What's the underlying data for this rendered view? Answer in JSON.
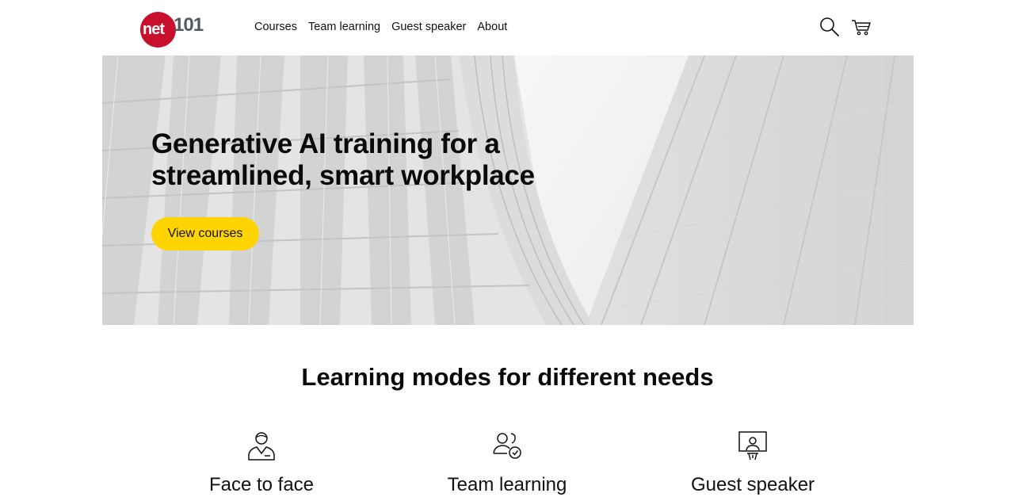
{
  "logo": {
    "prefix": "net",
    "suffix": "101",
    "brand_color": "#c8102e"
  },
  "nav": {
    "items": [
      {
        "label": "Courses"
      },
      {
        "label": "Team learning"
      },
      {
        "label": "Guest speaker"
      },
      {
        "label": "About"
      }
    ]
  },
  "header_icons": {
    "search": "search-icon",
    "cart": "cart-icon"
  },
  "hero": {
    "title": "Generative AI training for a streamlined, smart workplace",
    "cta_label": "View courses",
    "cta_color": "#ffd400"
  },
  "modes": {
    "title": "Learning modes for different needs",
    "items": [
      {
        "label": "Face to face",
        "icon": "person-icon"
      },
      {
        "label": "Team learning",
        "icon": "team-check-icon"
      },
      {
        "label": "Guest speaker",
        "icon": "presenter-icon"
      }
    ]
  }
}
